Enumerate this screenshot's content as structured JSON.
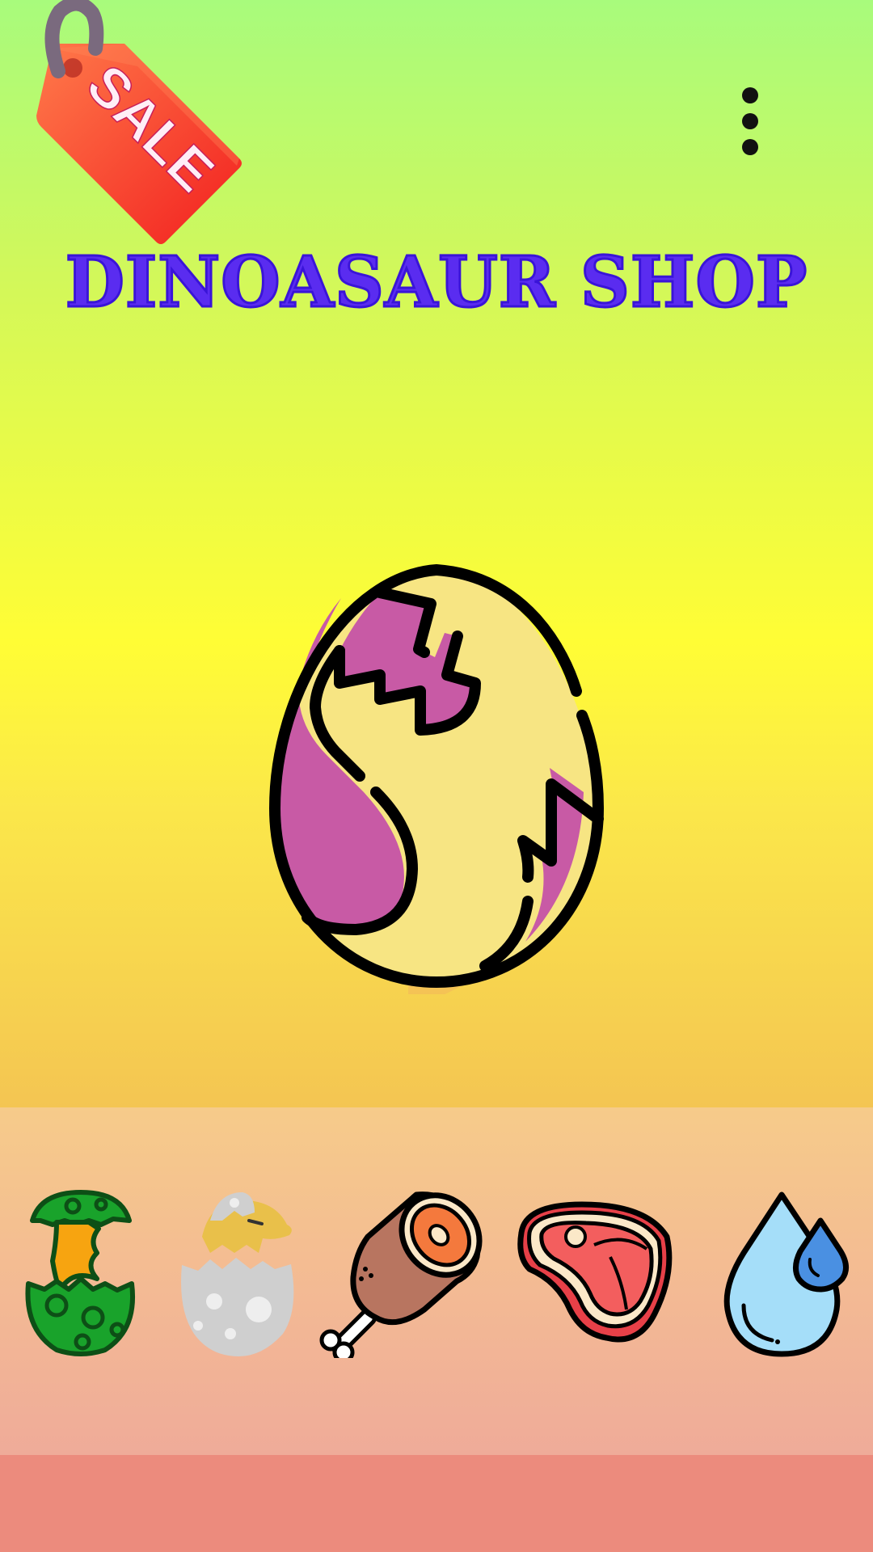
{
  "header": {
    "title": "DINOASAUR SHOP",
    "sale_tag_text": "SALE",
    "sale_tag_icon": "sale-tag-icon",
    "menu_icon": "more-vertical-icon"
  },
  "featured": {
    "icon": "cracked-dinosaur-egg-icon",
    "colors": {
      "shell": "#f7e583",
      "spots": "#c85aa5",
      "outline": "#000000"
    }
  },
  "shop_items": [
    {
      "icon": "green-hatching-egg-icon"
    },
    {
      "icon": "baby-dinosaur-hatching-icon"
    },
    {
      "icon": "meat-drumstick-icon"
    },
    {
      "icon": "steak-icon"
    },
    {
      "icon": "water-drop-icon"
    }
  ],
  "colors": {
    "title": "#5a2cf0",
    "background_top": "#a8fb7c",
    "background_middle": "#fffd35",
    "background_lower": "#f4c552",
    "tray": "#f6cb8a",
    "bottom_bar": "#ec8b7d"
  }
}
